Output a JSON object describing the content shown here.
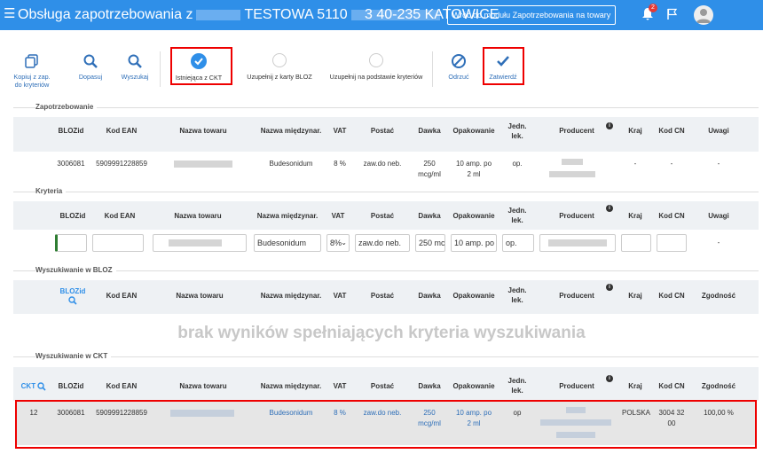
{
  "header": {
    "title_prefix": "Obsługa zapotrzebowania z",
    "title_mid": "TESTOWA 5110",
    "city": "3 40-235 KATOWICE",
    "back_button": "Wróć do modułu Zapotrzebowania na towary",
    "notification_count": "2",
    "colors": {
      "bar": "#2f8fe8"
    }
  },
  "toolbar": {
    "kopiuj": "Kopiuj z zap. do kryteriów",
    "dopasuj": "Dopasuj",
    "wyszukaj": "Wyszukaj",
    "istniejaca": "Istniejąca z CKT",
    "uzupelnij_bloz": "Uzupełnij z karty BLOZ",
    "uzupelnij_kryt": "Uzupełnij na podstawie kryteriów",
    "odrzuc": "Odrzuć",
    "zatwierdz": "Zatwierdź"
  },
  "sections": {
    "zapotrzebowanie": "Zapotrzebowanie",
    "kryteria": "Kryteria",
    "bloz": "Wyszukiwanie w BLOZ",
    "ckt": "Wyszukiwanie w CKT"
  },
  "columns": {
    "blozid": "BLOZid",
    "ean": "Kod EAN",
    "nazwa": "Nazwa towaru",
    "miedzynar": "Nazwa międzynar.",
    "vat": "VAT",
    "postac": "Postać",
    "dawka": "Dawka",
    "opakowanie": "Opakowanie",
    "jedn1": "Jedn.",
    "jedn2": "lek.",
    "producent": "Producent",
    "kraj": "Kraj",
    "kodcn": "Kod CN",
    "uwagi": "Uwagi",
    "zgodnosc": "Zgodność",
    "ckt": "CKT"
  },
  "zapotrzebowanie_row": {
    "blozid": "3006081",
    "ean": "5909991228859",
    "miedzynar": "Budesonidum",
    "vat": "8 %",
    "postac": "zaw.do neb.",
    "dawka1": "250",
    "dawka2": "mcg/ml",
    "opak1": "10 amp. po",
    "opak2": "2 ml",
    "jedn": "op.",
    "kraj": "-",
    "kodcn": "-",
    "uwagi": "-"
  },
  "kryteria_row": {
    "miedzynar": "Budesonidum",
    "vat": "8%",
    "postac": "zaw.do neb.",
    "dawka": "250 mc",
    "opak": "10 amp. po",
    "jedn": "op.",
    "uwagi": "-"
  },
  "bloz": {
    "no_results": "brak wyników spełniających kryteria wyszukiwania"
  },
  "ckt_row": {
    "ckt": "12",
    "blozid": "3006081",
    "ean": "5909991228859",
    "miedzynar": "Budesonidum",
    "vat": "8 %",
    "postac": "zaw.do neb.",
    "dawka1": "250",
    "dawka2": "mcg/ml",
    "opak1": "10 amp. po",
    "opak2": "2 ml",
    "jedn": "op",
    "kraj": "POLSKA",
    "kodcn1": "3004 32",
    "kodcn2": "00",
    "zgodnosc": "100,00 %"
  }
}
